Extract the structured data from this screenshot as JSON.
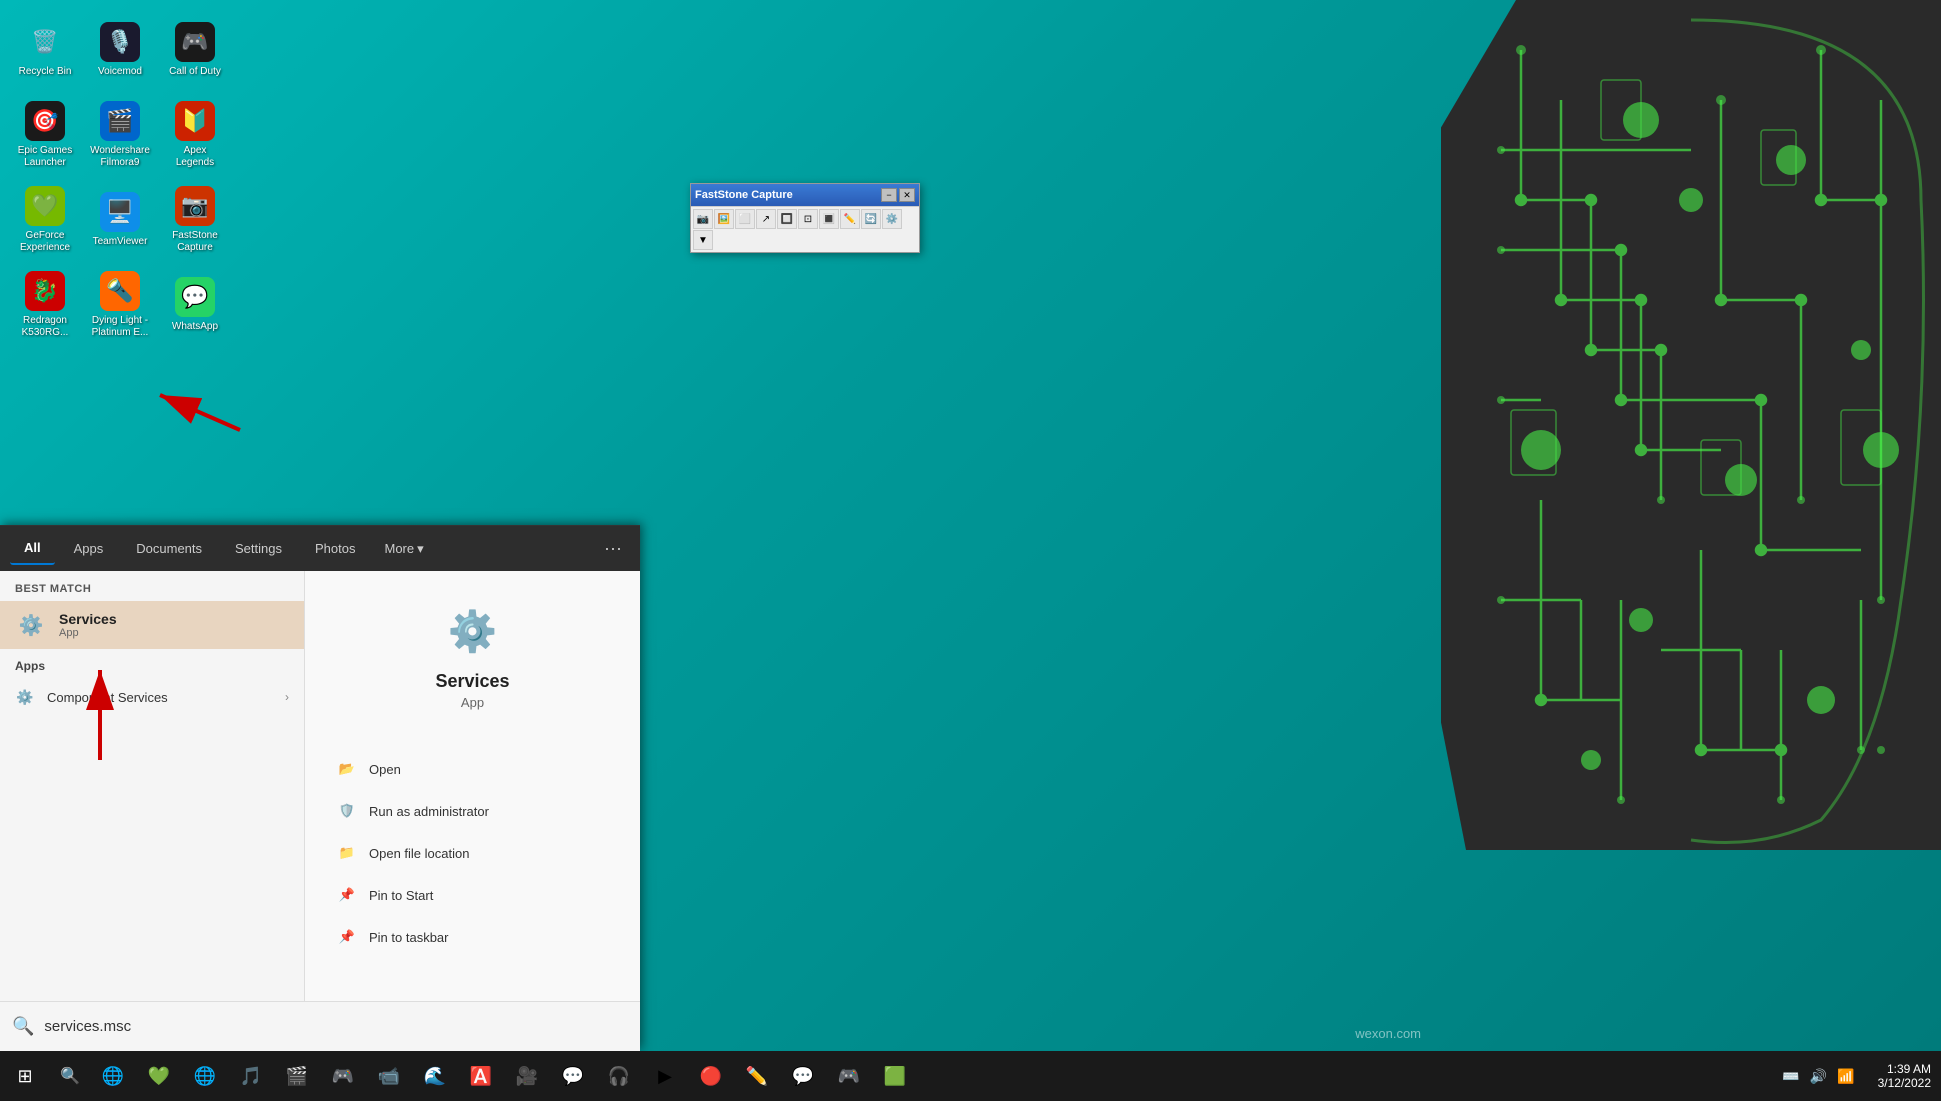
{
  "desktop": {
    "icons": [
      {
        "id": "recycle-bin",
        "label": "Recycle Bin",
        "emoji": "🗑️",
        "bg": "transparent",
        "row": 0,
        "col": 0
      },
      {
        "id": "voicemod",
        "label": "Voicemod",
        "emoji": "🎙️",
        "bg": "#1a1a2e",
        "row": 0,
        "col": 1
      },
      {
        "id": "call-of-duty",
        "label": "Call of Duty",
        "emoji": "🎮",
        "bg": "#1a1a1a",
        "row": 0,
        "col": 2
      },
      {
        "id": "epic-games",
        "label": "Epic Games Launcher",
        "emoji": "🎯",
        "bg": "#1a1a1a",
        "row": 1,
        "col": 0
      },
      {
        "id": "wondershare",
        "label": "Wondershare Filmora9",
        "emoji": "🎬",
        "bg": "#0066cc",
        "row": 1,
        "col": 1
      },
      {
        "id": "apex-legends",
        "label": "Apex Legends",
        "emoji": "🔰",
        "bg": "#cc2200",
        "row": 1,
        "col": 2
      },
      {
        "id": "geforce",
        "label": "GeForce Experience",
        "emoji": "💚",
        "bg": "#76b900",
        "row": 2,
        "col": 0
      },
      {
        "id": "teamviewer",
        "label": "TeamViewer",
        "emoji": "🖥️",
        "bg": "#0e8ee9",
        "row": 2,
        "col": 1
      },
      {
        "id": "faststone-cap",
        "label": "FastStone Capture",
        "emoji": "📷",
        "bg": "#cc3300",
        "row": 2,
        "col": 2
      },
      {
        "id": "redragon",
        "label": "Redragon K530RG...",
        "emoji": "🐉",
        "bg": "#cc0000",
        "row": 3,
        "col": 0
      },
      {
        "id": "dying-light",
        "label": "Dying Light - Platinum E...",
        "emoji": "🔦",
        "bg": "#ff6600",
        "row": 3,
        "col": 1
      },
      {
        "id": "whatsapp",
        "label": "WhatsApp",
        "emoji": "💬",
        "bg": "#25d366",
        "row": 3,
        "col": 2
      }
    ]
  },
  "faststone_window": {
    "title": "FastStone Capture",
    "min_btn": "−",
    "close_btn": "✕"
  },
  "start_menu": {
    "search_tabs": [
      {
        "id": "all",
        "label": "All",
        "active": true
      },
      {
        "id": "apps",
        "label": "Apps",
        "active": false
      },
      {
        "id": "documents",
        "label": "Documents",
        "active": false
      },
      {
        "id": "settings",
        "label": "Settings",
        "active": false
      },
      {
        "id": "photos",
        "label": "Photos",
        "active": false
      },
      {
        "id": "more",
        "label": "More",
        "active": false,
        "has_arrow": true
      }
    ],
    "best_match_label": "Best match",
    "services_result": {
      "name": "Services",
      "type": "App",
      "emoji": "⚙️"
    },
    "apps_label": "Apps",
    "component_services": {
      "name": "Component Services",
      "has_arrow": true
    },
    "app_preview": {
      "name": "Services",
      "type": "App",
      "emoji": "⚙️"
    },
    "actions": [
      {
        "id": "open",
        "label": "Open",
        "icon": "📂"
      },
      {
        "id": "run-as-admin",
        "label": "Run as administrator",
        "icon": "🛡️"
      },
      {
        "id": "open-file-location",
        "label": "Open file location",
        "icon": "📁"
      },
      {
        "id": "pin-to-start",
        "label": "Pin to Start",
        "icon": "📌"
      },
      {
        "id": "pin-to-taskbar",
        "label": "Pin to taskbar",
        "icon": "📌"
      }
    ],
    "search_query": "services.msc",
    "search_placeholder": "services.msc"
  },
  "taskbar": {
    "start_label": "⊞",
    "items": [
      {
        "id": "search",
        "icon": "🔍"
      },
      {
        "id": "edge-1",
        "icon": "🌐"
      },
      {
        "id": "nvidia",
        "icon": "💚"
      },
      {
        "id": "chrome",
        "icon": "🌐"
      },
      {
        "id": "spotify",
        "icon": "🎵"
      },
      {
        "id": "premiere",
        "icon": "🎬"
      },
      {
        "id": "epic",
        "icon": "🎮"
      },
      {
        "id": "zoom",
        "icon": "📹"
      },
      {
        "id": "edge-2",
        "icon": "🌊"
      },
      {
        "id": "adobe",
        "icon": "🅰️"
      },
      {
        "id": "obs",
        "icon": "🎥"
      },
      {
        "id": "discord",
        "icon": "💬"
      },
      {
        "id": "teamspeak",
        "icon": "🎧"
      },
      {
        "id": "arrow",
        "icon": "▶"
      },
      {
        "id": "unknown1",
        "icon": "🔴"
      },
      {
        "id": "wacom",
        "icon": "✏️"
      },
      {
        "id": "whatsapp-tb",
        "icon": "💬"
      },
      {
        "id": "steam",
        "icon": "🎮"
      },
      {
        "id": "green",
        "icon": "🟩"
      }
    ],
    "tray": {
      "icons": [
        "⌨️",
        "🔊",
        "📶"
      ],
      "time": "1:39 AM",
      "date": "3/12/2022"
    }
  },
  "watermark": "wexon.com"
}
